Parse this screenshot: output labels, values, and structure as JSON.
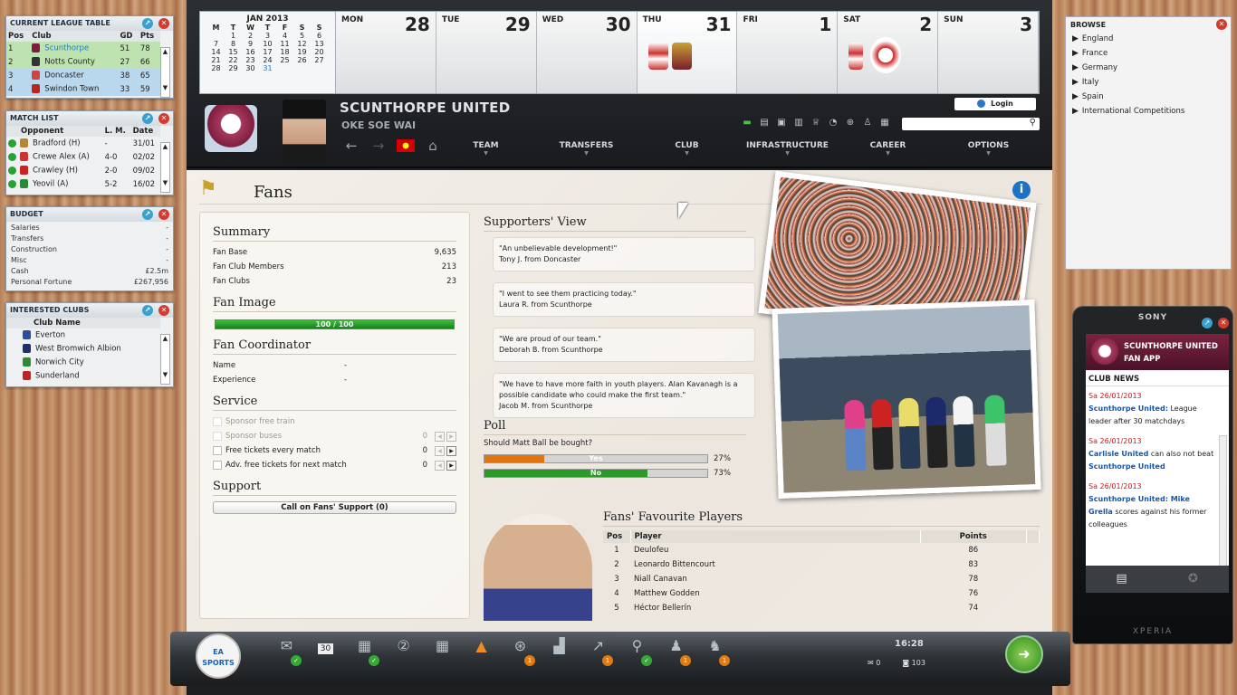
{
  "league_table": {
    "title": "CURRENT LEAGUE TABLE",
    "headers": [
      "Pos",
      "Club",
      "GD",
      "Pts"
    ],
    "rows": [
      {
        "pos": "1",
        "club": "Scunthorpe",
        "gd": "51",
        "pts": "78"
      },
      {
        "pos": "2",
        "club": "Notts County",
        "gd": "27",
        "pts": "66"
      },
      {
        "pos": "3",
        "club": "Doncaster",
        "gd": "38",
        "pts": "65"
      },
      {
        "pos": "4",
        "club": "Swindon Town",
        "gd": "33",
        "pts": "59"
      }
    ]
  },
  "match_list": {
    "title": "MATCH LIST",
    "headers": [
      "Opponent",
      "L. M.",
      "Date"
    ],
    "rows": [
      {
        "opp": "Bradford (H)",
        "lm": "-",
        "date": "31/01"
      },
      {
        "opp": "Crewe Alex (A)",
        "lm": "4-0",
        "date": "02/02"
      },
      {
        "opp": "Crawley (H)",
        "lm": "2-0",
        "date": "09/02"
      },
      {
        "opp": "Yeovil (A)",
        "lm": "5-2",
        "date": "16/02"
      }
    ]
  },
  "budget": {
    "title": "BUDGET",
    "rows": [
      {
        "k": "Salaries",
        "v": "-"
      },
      {
        "k": "Transfers",
        "v": "-"
      },
      {
        "k": "Construction",
        "v": "-"
      },
      {
        "k": "Misc",
        "v": "-"
      },
      {
        "k": "Cash",
        "v": "£2.5m"
      },
      {
        "k": "Personal Fortune",
        "v": "£267,956"
      }
    ]
  },
  "interested_clubs": {
    "title": "INTERESTED CLUBS",
    "header": "Club Name",
    "rows": [
      "Everton",
      "West Bromwich Albion",
      "Norwich City",
      "Sunderland"
    ]
  },
  "calendar": {
    "month": "JAN 2013",
    "weekday_heads": [
      "M",
      "T",
      "W",
      "T",
      "F",
      "S",
      "S"
    ],
    "weeks": [
      [
        "",
        "1",
        "2",
        "3",
        "4",
        "5",
        "6"
      ],
      [
        "7",
        "8",
        "9",
        "10",
        "11",
        "12",
        "13"
      ],
      [
        "14",
        "15",
        "16",
        "17",
        "18",
        "19",
        "20"
      ],
      [
        "21",
        "22",
        "23",
        "24",
        "25",
        "26",
        "27"
      ],
      [
        "28",
        "29",
        "30",
        "31",
        "",
        "",
        ""
      ]
    ],
    "days": [
      {
        "name": "MON",
        "num": "28"
      },
      {
        "name": "TUE",
        "num": "29"
      },
      {
        "name": "WED",
        "num": "30"
      },
      {
        "name": "THU",
        "num": "31"
      },
      {
        "name": "FRI",
        "num": "1"
      },
      {
        "name": "SAT",
        "num": "2"
      },
      {
        "name": "SUN",
        "num": "3"
      }
    ]
  },
  "header": {
    "club_name": "SCUNTHORPE UNITED",
    "manager_name": "OKE SOE WAI",
    "login_label": "Login",
    "menu": [
      "TEAM",
      "TRANSFERS",
      "CLUB",
      "INFRASTRUCTURE",
      "CAREER",
      "OPTIONS"
    ]
  },
  "page": {
    "title": "Fans",
    "summary": {
      "title": "Summary",
      "rows": [
        {
          "k": "Fan Base",
          "v": "9,635"
        },
        {
          "k": "Fan Club Members",
          "v": "213"
        },
        {
          "k": "Fan Clubs",
          "v": "23"
        }
      ]
    },
    "fan_image": {
      "title": "Fan Image",
      "label": "100 / 100",
      "value": 100,
      "max": 100
    },
    "coordinator": {
      "title": "Fan Coordinator",
      "rows": [
        {
          "k": "Name",
          "v": "-"
        },
        {
          "k": "Experience",
          "v": "-"
        }
      ]
    },
    "service": {
      "title": "Service",
      "rows": [
        {
          "k": "Sponsor free train",
          "v": "",
          "enabled": false
        },
        {
          "k": "Sponsor buses",
          "v": "0",
          "enabled": false
        },
        {
          "k": "Free tickets every match",
          "v": "0",
          "enabled": true
        },
        {
          "k": "Adv. free tickets for next match",
          "v": "0",
          "enabled": true
        }
      ]
    },
    "support": {
      "title": "Support",
      "button": "Call on Fans' Support (0)"
    },
    "supporters_view": {
      "title": "Supporters' View",
      "quotes": [
        {
          "q": "\"An unbelievable development!\"",
          "who": "Tony J. from Doncaster"
        },
        {
          "q": "\"I went to see them practicing today.\"",
          "who": "Laura R. from Scunthorpe"
        },
        {
          "q": "\"We are proud of our team.\"",
          "who": "Deborah B. from Scunthorpe"
        },
        {
          "q": "\"We have to have more faith in youth players. Alan Kavanagh is a possible candidate who could make the first team.\"",
          "who": "Jacob M. from Scunthorpe"
        }
      ]
    },
    "poll": {
      "title": "Poll",
      "question": "Should Matt Ball be bought?",
      "options": [
        {
          "label": "Yes",
          "pct_label": "27%",
          "value": 27,
          "color": "#e0750f"
        },
        {
          "label": "No",
          "pct_label": "73%",
          "value": 73,
          "color": "#2a9b26"
        }
      ]
    },
    "favourite_players": {
      "title": "Fans' Favourite Players",
      "headers": [
        "Pos",
        "Player",
        "Points"
      ],
      "rows": [
        {
          "pos": "1",
          "player": "Deulofeu",
          "pts": "86"
        },
        {
          "pos": "2",
          "player": "Leonardo Bittencourt",
          "pts": "83"
        },
        {
          "pos": "3",
          "player": "Niall Canavan",
          "pts": "78"
        },
        {
          "pos": "4",
          "player": "Matthew Godden",
          "pts": "76"
        },
        {
          "pos": "5",
          "player": "Héctor Bellerín",
          "pts": "74"
        }
      ]
    }
  },
  "bottom": {
    "ea_label": "EA SPORTS",
    "calendar_badge": "30",
    "clock": "16:28",
    "messages": "0",
    "posts": "103",
    "badges": [
      "1",
      "1",
      "1",
      "1",
      "1"
    ]
  },
  "browse": {
    "title": "BROWSE",
    "items": [
      "England",
      "France",
      "Germany",
      "Italy",
      "Spain",
      "International Competitions"
    ]
  },
  "phone": {
    "brand": "SONY",
    "app_title_1": "SCUNTHORPE UNITED",
    "app_title_2": "FAN APP",
    "news_title": "CLUB NEWS",
    "news": [
      {
        "date": "Sa 26/01/2013",
        "team": "Scunthorpe United:",
        "text": " League leader after 30 matchdays"
      },
      {
        "date": "Sa 26/01/2013",
        "team": "Carlisle United",
        "text": " can also not beat ",
        "team2": "Scunthorpe United"
      },
      {
        "date": "Sa 26/01/2013",
        "team": "Scunthorpe United: Mike Grella",
        "text": " scores against his former colleagues"
      }
    ],
    "footer": "XPERIA"
  },
  "colors": {
    "accent_blue": "#1c73c4",
    "green": "#2a9b26",
    "orange": "#e0750f",
    "claret": "#7a2240"
  }
}
